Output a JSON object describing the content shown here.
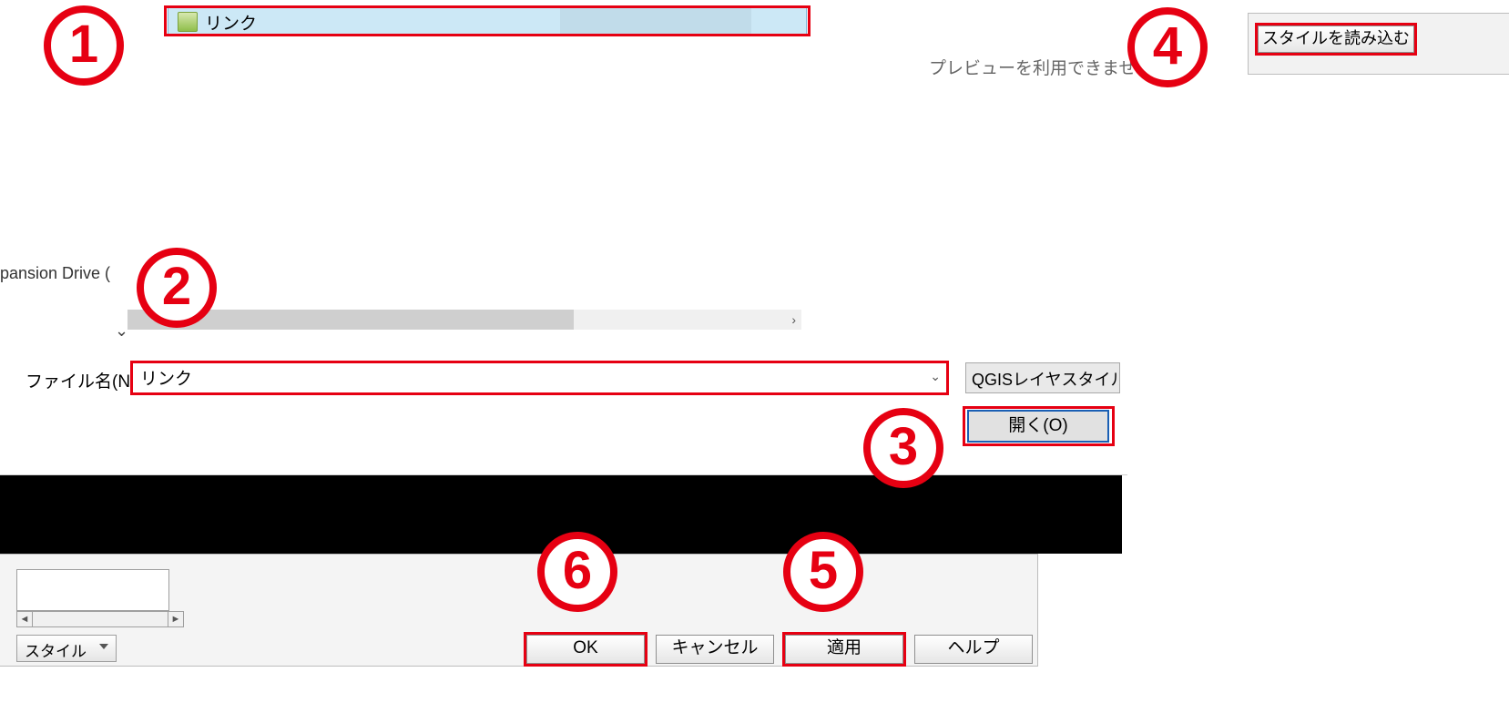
{
  "dialog": {
    "selected_file": "リンク",
    "nav_drive_label": "pansion Drive (",
    "preview_message": "プレビューを利用できませ",
    "filename_label": "ファイル名(N):",
    "filename_value": "リンク",
    "filetype_label": "QGISレイヤスタイル",
    "open_button": "開く(O)"
  },
  "lower": {
    "style_dropdown": "スタイル",
    "ok": "OK",
    "cancel": "キャンセル",
    "apply": "適用",
    "help": "ヘルプ"
  },
  "aux": {
    "load_style": "スタイルを読み込む"
  },
  "callouts": {
    "c1": "1",
    "c2": "2",
    "c3": "3",
    "c4": "4",
    "c5": "5",
    "c6": "6"
  }
}
